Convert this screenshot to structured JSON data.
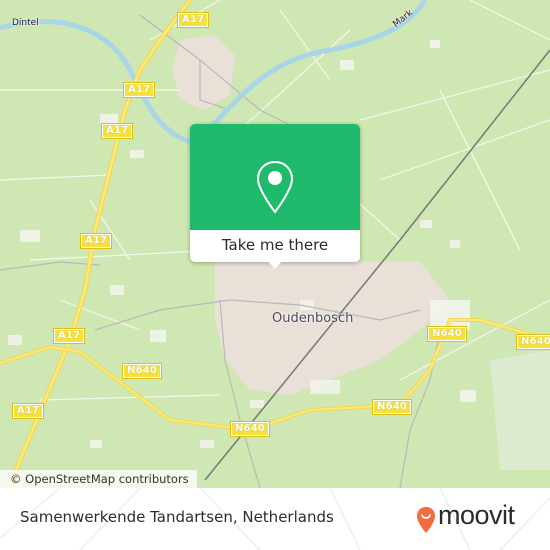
{
  "map": {
    "place_label": "Oudenbosch",
    "river_labels": [
      "Dintel",
      "Mark"
    ],
    "road_shields": [
      {
        "id": "a17-top",
        "text": "A17"
      },
      {
        "id": "a17-upper",
        "text": "A17"
      },
      {
        "id": "a17-mid1",
        "text": "A17"
      },
      {
        "id": "a17-mid2",
        "text": "A17"
      },
      {
        "id": "a17-lower",
        "text": "A17"
      },
      {
        "id": "a17-bottom",
        "text": "A17"
      },
      {
        "id": "n640-east",
        "text": "N640"
      },
      {
        "id": "n640-mid",
        "text": "N640"
      },
      {
        "id": "n640-center",
        "text": "N640"
      },
      {
        "id": "n640-south",
        "text": "N640"
      },
      {
        "id": "n640-west",
        "text": "N640"
      }
    ],
    "attribution": "© OpenStreetMap contributors"
  },
  "popup": {
    "icon": "map-pin-icon",
    "cta_label": "Take me there",
    "accent_color": "#1fba6c"
  },
  "footer": {
    "title": "Samenwerkende Tandartsen, Netherlands",
    "brand": "moovit",
    "brand_color": "#f26d3d"
  }
}
